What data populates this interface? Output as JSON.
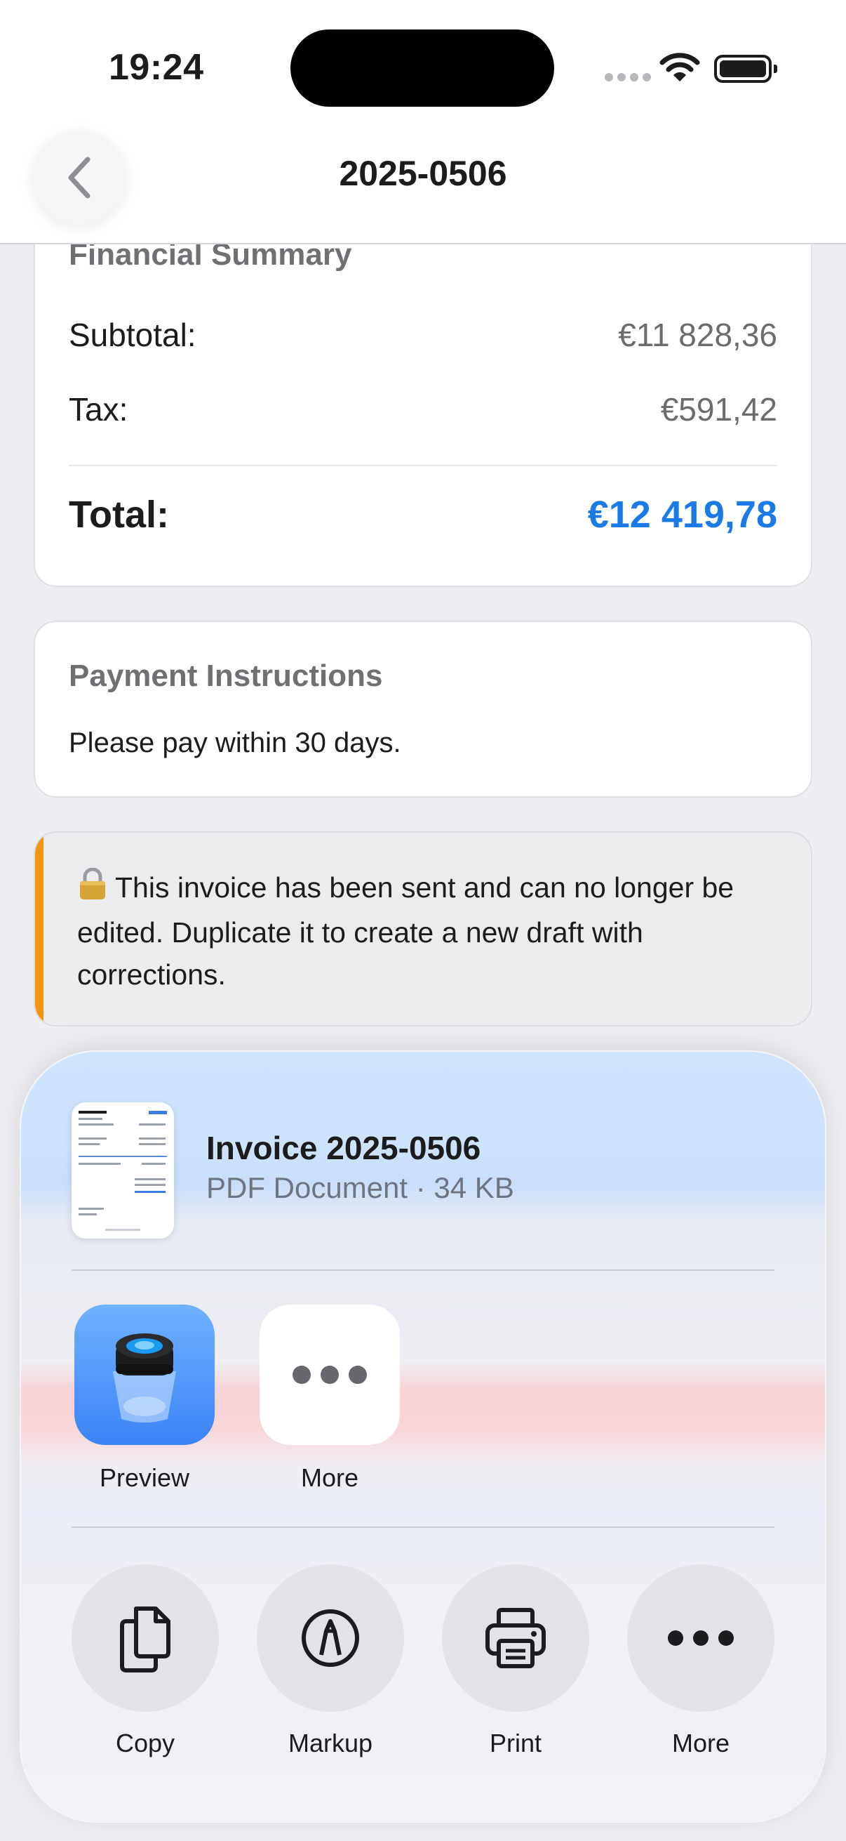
{
  "status_bar": {
    "time": "19:24"
  },
  "nav": {
    "title": "2025-0506"
  },
  "financial_summary": {
    "heading": "Financial Summary",
    "subtotal_label": "Subtotal:",
    "subtotal_value": "€11 828,36",
    "tax_label": "Tax:",
    "tax_value": "€591,42",
    "total_label": "Total:",
    "total_value": "€12 419,78"
  },
  "payment_instructions": {
    "heading": "Payment Instructions",
    "text": "Please pay within 30 days."
  },
  "lock_notice": {
    "icon": "lock-icon",
    "text": "This invoice has been sent and can no longer be edited. Duplicate it to create a new draft with corrections."
  },
  "share_sheet": {
    "document": {
      "title": "Invoice 2025-0506",
      "subtitle": "PDF Document · 34 KB"
    },
    "apps": [
      {
        "label": "Preview",
        "icon": "preview-app-icon"
      },
      {
        "label": "More",
        "icon": "more-icon"
      }
    ],
    "actions": [
      {
        "label": "Copy",
        "icon": "copy-icon"
      },
      {
        "label": "Markup",
        "icon": "markup-icon"
      },
      {
        "label": "Print",
        "icon": "printer-icon"
      },
      {
        "label": "More",
        "icon": "more-icon"
      }
    ]
  },
  "colors": {
    "accent_blue": "#1a7ae8",
    "warning_orange": "#f29511"
  }
}
